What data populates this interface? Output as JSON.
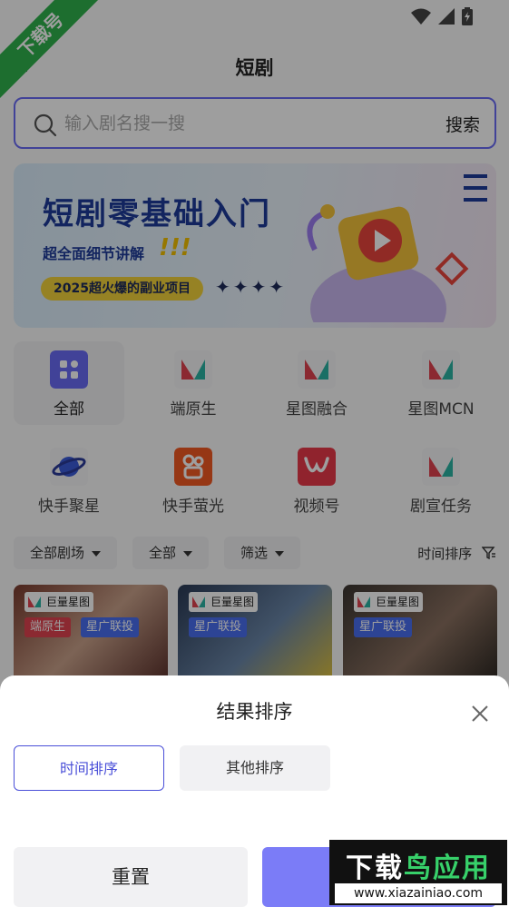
{
  "watermark_corner": "下载号",
  "nav": {
    "back_glyph": "‹",
    "title": "短剧"
  },
  "search": {
    "placeholder": "输入剧名搜一搜",
    "button": "搜索"
  },
  "banner": {
    "title": "短剧零基础入门",
    "subtitle": "超全面细节讲解",
    "exclaim": "!!!",
    "pill": "2025超火爆的副业项目",
    "stars": "✦✦✦✦"
  },
  "categories": [
    {
      "label": "全部",
      "icon": "grid-icon",
      "active": true
    },
    {
      "label": "端原生",
      "icon": "xingtu-logo-icon",
      "active": false
    },
    {
      "label": "星图融合",
      "icon": "xingtu-logo-icon",
      "active": false
    },
    {
      "label": "星图MCN",
      "icon": "xingtu-logo-icon",
      "active": false
    },
    {
      "label": "快手聚星",
      "icon": "kuaishou-star-icon",
      "active": false
    },
    {
      "label": "快手萤光",
      "icon": "kuaishou-icon",
      "active": false
    },
    {
      "label": "视频号",
      "icon": "channels-icon",
      "active": false
    },
    {
      "label": "剧宣任务",
      "icon": "xingtu-logo-icon",
      "active": false
    }
  ],
  "filters": {
    "theater": "全部剧场",
    "all": "全部",
    "screen": "筛选",
    "sort": "时间排序"
  },
  "cards": [
    {
      "brand": "巨量星图",
      "tags": [
        "端原生",
        "星广联投"
      ]
    },
    {
      "brand": "巨量星图",
      "tags": [
        "星广联投"
      ]
    },
    {
      "brand": "巨量星图",
      "tags": [
        "星广联投"
      ]
    }
  ],
  "sheet": {
    "title": "结果排序",
    "option_time": "时间排序",
    "option_other": "其他排序",
    "reset": "重置"
  },
  "watermark": {
    "title_a": "下载",
    "title_b": "鸟应用",
    "url": "www.xiazainiao.com"
  },
  "colors": {
    "accent": "#6a6bf5",
    "confirm": "#7b7cf7",
    "tag_red": "#e0434f",
    "tag_blue": "#4a6ef0"
  }
}
